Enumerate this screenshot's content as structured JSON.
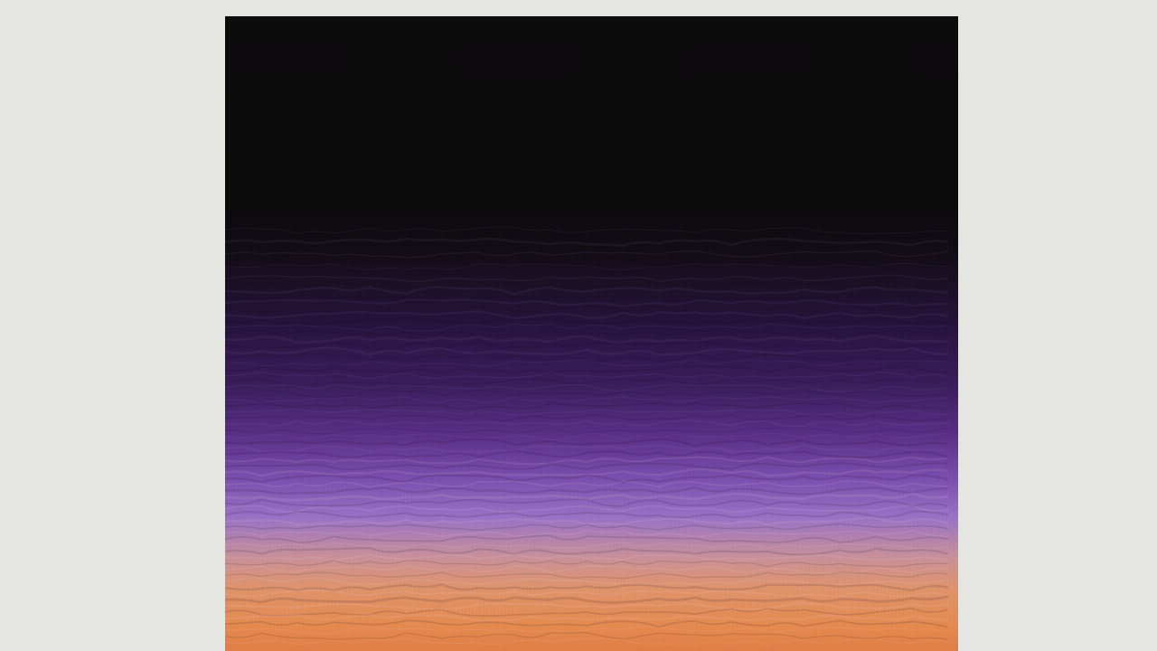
{
  "viewer": {
    "background_color": "#e5e5e1"
  },
  "artwork": {
    "description_icon": "abstract-gradient-painting",
    "colors": {
      "top": "#0a090a",
      "middle": "#3a1c5c",
      "lavender": "#9a72c6",
      "bottom": "#e07f45"
    }
  }
}
